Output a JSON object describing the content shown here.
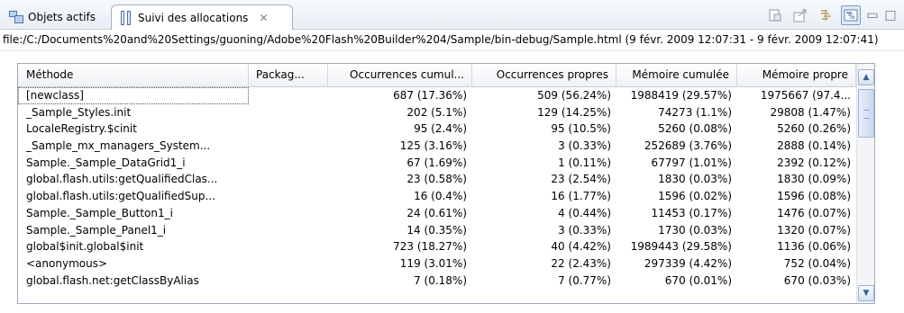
{
  "tabs": [
    {
      "label": "Objets actifs",
      "icon": "objects-icon",
      "active": false
    },
    {
      "label": "Suivi des allocations",
      "icon": "allocation-trace-icon",
      "active": true
    }
  ],
  "path": "file:/C:/Documents%20and%20Settings/guoning/Adobe%20Flash%20Builder%204/Sample/bin-debug/Sample.html (9 févr. 2009 12:07:31 - 9 févr. 2009 12:07:41)",
  "table": {
    "columns": [
      "Méthode",
      "Packag...",
      "Occurrences cumul...",
      "Occurrences propres",
      "Mémoire cumulée",
      "Mémoire propre"
    ],
    "rows": [
      [
        "[newclass]",
        "",
        "687 (17.36%)",
        "509 (56.24%)",
        "1988419 (29.57%)",
        "1975667 (97.4..."
      ],
      [
        "_Sample_Styles.init",
        "",
        "202 (5.1%)",
        "129 (14.25%)",
        "74273 (1.1%)",
        "29808 (1.47%)"
      ],
      [
        "LocaleRegistry.$cinit",
        "",
        "95 (2.4%)",
        "95 (10.5%)",
        "5260 (0.08%)",
        "5260 (0.26%)"
      ],
      [
        "_Sample_mx_managers_System...",
        "",
        "125 (3.16%)",
        "3 (0.33%)",
        "252689 (3.76%)",
        "2888 (0.14%)"
      ],
      [
        "Sample._Sample_DataGrid1_i",
        "",
        "67 (1.69%)",
        "1 (0.11%)",
        "67797 (1.01%)",
        "2392 (0.12%)"
      ],
      [
        "global.flash.utils:getQualifiedClas...",
        "",
        "23 (0.58%)",
        "23 (2.54%)",
        "1830 (0.03%)",
        "1830 (0.09%)"
      ],
      [
        "global.flash.utils:getQualifiedSup...",
        "",
        "16 (0.4%)",
        "16 (1.77%)",
        "1596 (0.02%)",
        "1596 (0.08%)"
      ],
      [
        "Sample._Sample_Button1_i",
        "",
        "24 (0.61%)",
        "4 (0.44%)",
        "11453 (0.17%)",
        "1476 (0.07%)"
      ],
      [
        "Sample._Sample_Panel1_i",
        "",
        "14 (0.35%)",
        "3 (0.33%)",
        "1730 (0.03%)",
        "1320 (0.07%)"
      ],
      [
        "global$init.global$init",
        "",
        "723 (18.27%)",
        "40 (4.42%)",
        "1989443 (29.58%)",
        "1136 (0.06%)"
      ],
      [
        "<anonymous>",
        "",
        "119 (3.01%)",
        "22 (2.43%)",
        "297339 (4.42%)",
        "752 (0.04%)"
      ],
      [
        "global.flash.net:getClassByAlias",
        "",
        "7 (0.18%)",
        "7 (0.77%)",
        "670 (0.01%)",
        "670 (0.03%)"
      ]
    ]
  },
  "toolbar_icons": [
    "open-source-icon",
    "export-icon",
    "filter-icon",
    "percentage-toggle-icon",
    "minimize-icon",
    "maximize-icon"
  ],
  "colors": {
    "accent": "#4b74b8",
    "header_bg": "#eef1f5",
    "border": "#9fa9b6"
  }
}
